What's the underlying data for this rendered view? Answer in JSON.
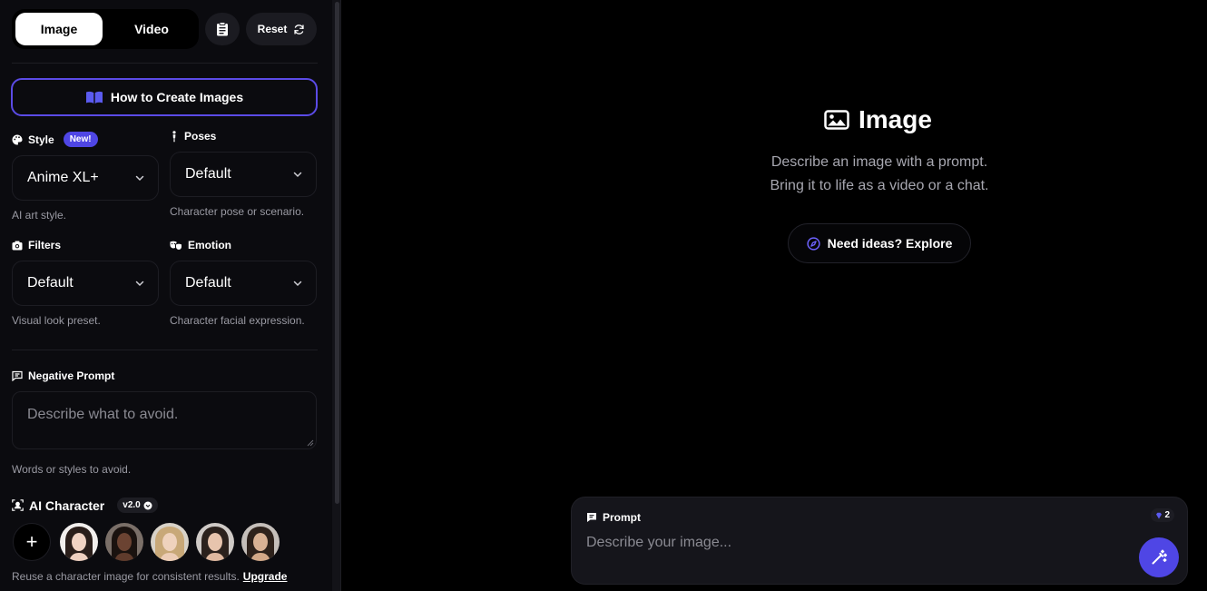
{
  "mode_toggle": {
    "image_label": "Image",
    "video_label": "Video",
    "selected": "Image"
  },
  "toolbar": {
    "reset_label": "Reset"
  },
  "howto": {
    "label": "How to Create Images"
  },
  "style": {
    "label": "Style",
    "badge": "New!",
    "value": "Anime XL+",
    "hint": "AI art style."
  },
  "poses": {
    "label": "Poses",
    "value": "Default",
    "hint": "Character pose or scenario."
  },
  "filters": {
    "label": "Filters",
    "value": "Default",
    "hint": "Visual look preset."
  },
  "emotion": {
    "label": "Emotion",
    "value": "Default",
    "hint": "Character facial expression."
  },
  "negative_prompt": {
    "label": "Negative Prompt",
    "placeholder": "Describe what to avoid.",
    "hint": "Words or styles to avoid."
  },
  "ai_character": {
    "label": "AI Character",
    "version": "v2.0",
    "add_label": "+",
    "hint": "Reuse a character image for consistent results.",
    "upgrade_label": "Upgrade"
  },
  "hero": {
    "title": "Image",
    "line1": "Describe an image with a prompt.",
    "line2": "Bring it to life as a video or a chat.",
    "explore_label": "Need ideas? Explore"
  },
  "prompt": {
    "label": "Prompt",
    "placeholder": "Describe your image...",
    "credits": "2"
  },
  "colors": {
    "accent": "#4f46e5",
    "panel": "#15151b",
    "sidebar": "#0b0b0f"
  }
}
